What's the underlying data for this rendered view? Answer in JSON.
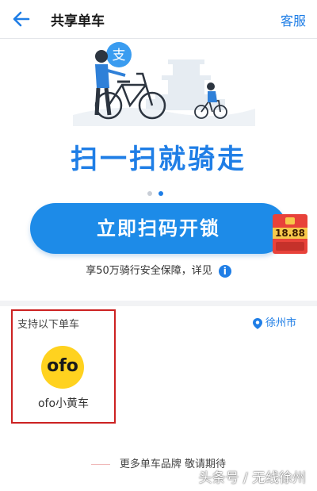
{
  "nav": {
    "back_icon": "arrow-left-icon",
    "title": "共享单车",
    "service": "客服"
  },
  "banner": {
    "slogan": "扫一扫就骑走",
    "page_dots": 2,
    "active_dot": 1
  },
  "scan_button": {
    "label": "立即扫码开锁"
  },
  "insurance_note": "享50万骑行安全保障，详见",
  "info_icon_glyph": "i",
  "red_packet": {
    "amount": "18.88"
  },
  "support": {
    "title": "支持以下单车",
    "city": "徐州市",
    "brands": [
      {
        "logo_text": "ofo",
        "name": "ofo小黄车"
      }
    ],
    "more_text": "更多单车品牌  敬请期待"
  },
  "watermark": "头条号 / 无线徐州",
  "colors": {
    "accent": "#1f7ee6",
    "button": "#1d8be8",
    "ofo_yellow": "#ffd21f",
    "red_packet": "#e8423a",
    "highlight_border": "#cc2222"
  }
}
